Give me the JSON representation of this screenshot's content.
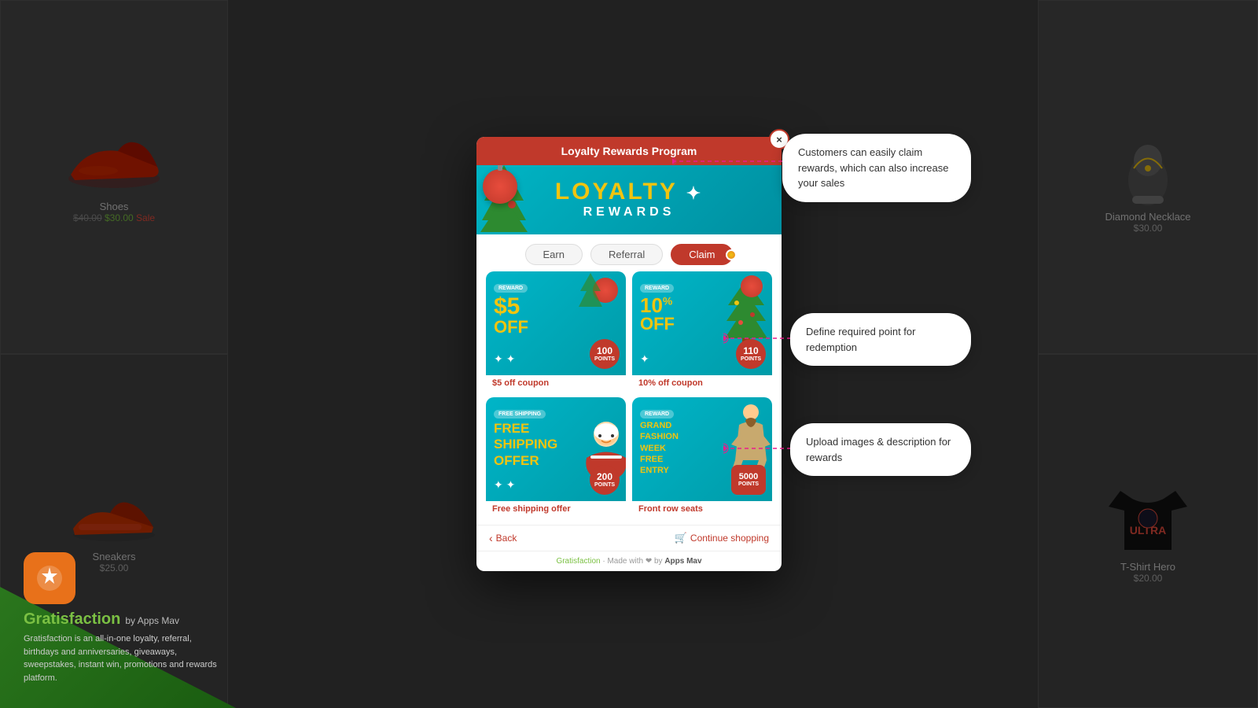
{
  "background": {
    "overlay_color": "rgba(0,0,0,0.55)"
  },
  "branding": {
    "logo_icon": "star-icon",
    "name": "Gratisfaction",
    "by_label": "by Apps Mav",
    "description": "Gratisfaction is an all-in-one loyalty, referral, birthdays and anniversaries, giveaways, sweepstakes, instant win, promotions and rewards platform."
  },
  "modal": {
    "header_title": "Loyalty Rewards Program",
    "close_label": "×",
    "banner": {
      "loyalty_text": "LOYALTY",
      "star_symbol": "✦",
      "rewards_text": "REWARDS"
    },
    "tabs": [
      {
        "label": "Earn",
        "active": false
      },
      {
        "label": "Referral",
        "active": false
      },
      {
        "label": "Claim",
        "active": true
      }
    ],
    "rewards": [
      {
        "badge": "REWARD",
        "amount": "$5",
        "off": "OFF",
        "label": "$5 off coupon",
        "points": "100",
        "points_label": "POINTS",
        "type": "dollar"
      },
      {
        "badge": "REWARD",
        "amount": "10%",
        "off": "OFF",
        "label": "10% off coupon",
        "points": "110",
        "points_label": "POINTS",
        "type": "percent"
      },
      {
        "badge": "FREE SHIPPING",
        "amount": "FREE\nSHIPPING\nOFFER",
        "off": "",
        "label": "Free shipping offer",
        "points": "200",
        "points_label": "POINTS",
        "type": "free"
      },
      {
        "badge": "REWARD",
        "amount": "GRAND\nFASHION\nWEEK\nFREE\nENTRY",
        "off": "",
        "label": "Front row seats",
        "points": "5000",
        "points_label": "POINTS",
        "type": "grand"
      }
    ],
    "footer": {
      "back_label": "Back",
      "continue_label": "Continue shopping"
    },
    "brand_footer": "Gratisfaction · Made with ❤ by Apps Mav"
  },
  "callouts": [
    {
      "id": "callout-1",
      "text": "Customers can easily claim rewards, which can also increase your sales"
    },
    {
      "id": "callout-2",
      "text": "Define required point for redemption"
    },
    {
      "id": "callout-3",
      "text": "Upload images & description for rewards"
    }
  ],
  "products": [
    {
      "name": "Shoes",
      "price": "$30.00",
      "original": "$40.00"
    },
    {
      "name": "Diamond Necklace",
      "price": "$30.00"
    },
    {
      "name": "Sneakers",
      "price": "$25.00"
    },
    {
      "name": "T-Shirt Hero",
      "price": "$20.00"
    }
  ]
}
